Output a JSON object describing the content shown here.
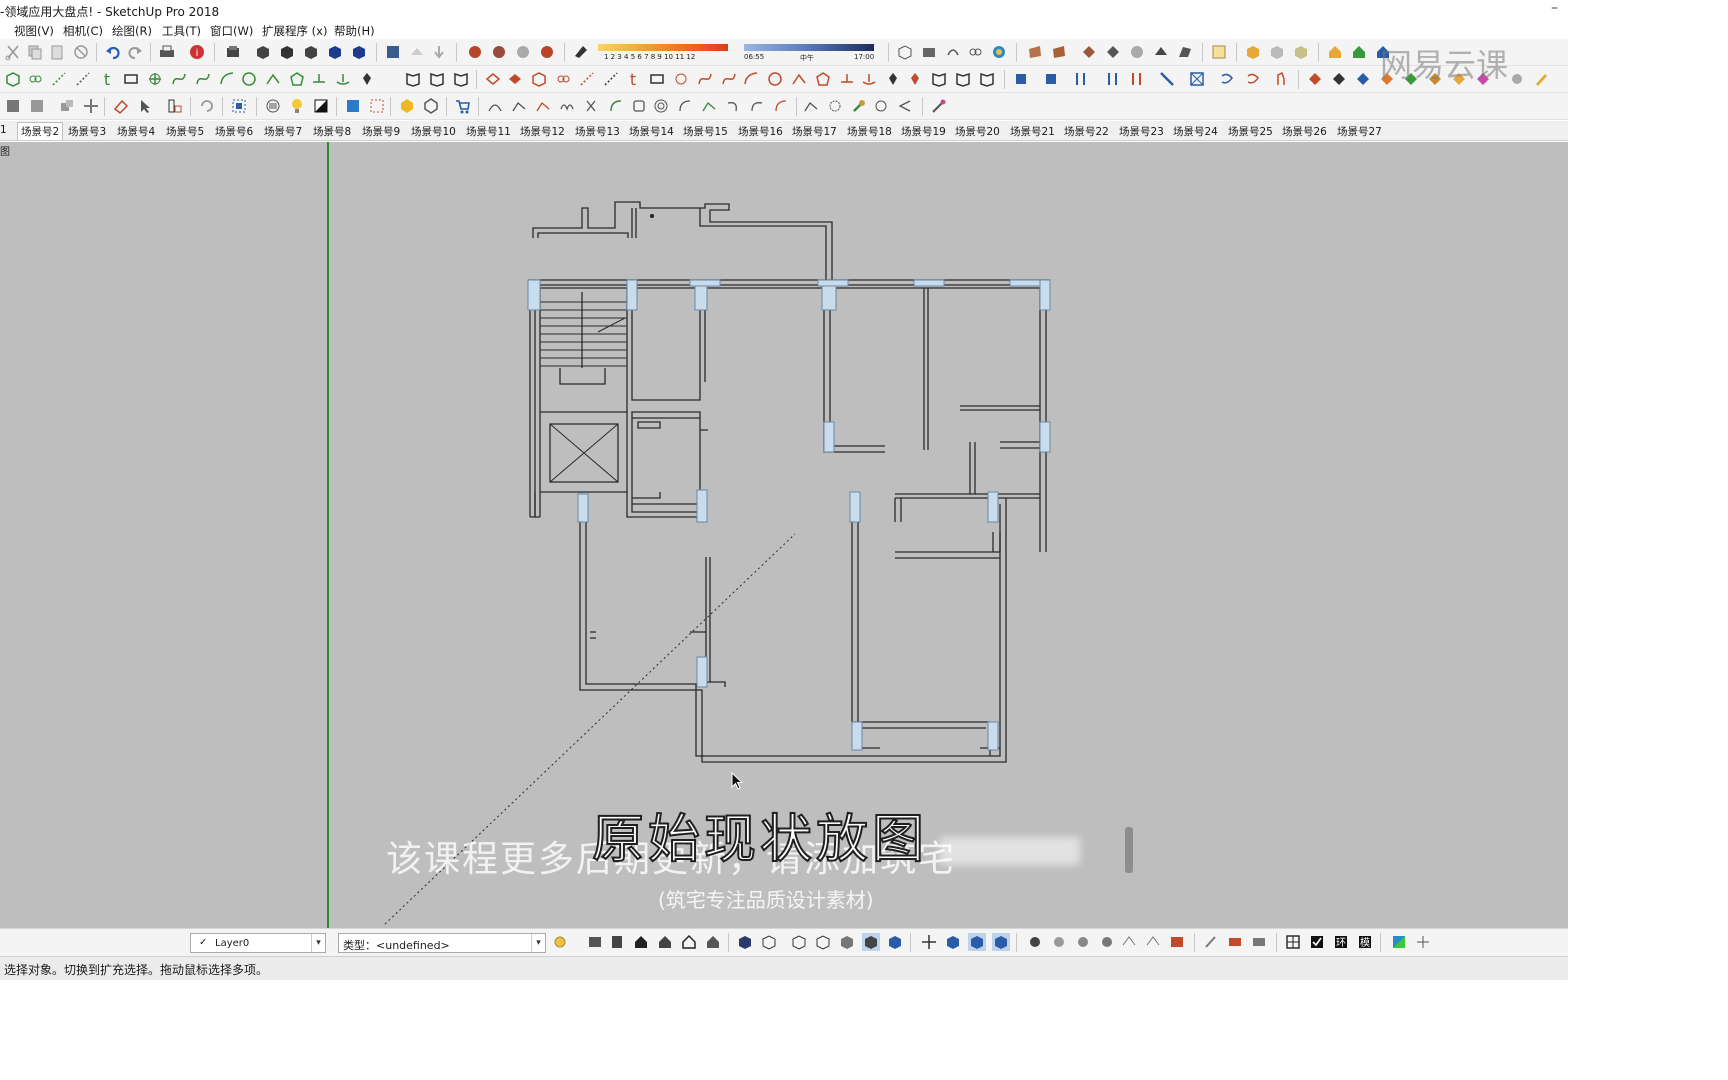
{
  "window": {
    "title": "-领域应用大盘点! - SketchUp Pro 2018",
    "minimize_glyph": "–"
  },
  "menu": {
    "items": [
      "视图(V)",
      "相机(C)",
      "绘图(R)",
      "工具(T)",
      "窗口(W)",
      "扩展程序 (x)",
      "帮助(H)"
    ]
  },
  "shadow_settings": {
    "months": "1 2 3 4 5 6 7 8 9 10 11 12",
    "time_start": "06:55",
    "noon": "中午",
    "time_end": "17:00"
  },
  "scene_tabs": {
    "items": [
      "1",
      "场景号2",
      "场景号3",
      "场景号4",
      "场景号5",
      "场景号6",
      "场景号7",
      "场景号8",
      "场景号9",
      "场景号10",
      "场景号11",
      "场景号12",
      "场景号13",
      "场景号14",
      "场景号15",
      "场景号16",
      "场景号17",
      "场景号18",
      "场景号19",
      "场景号20",
      "场景号21",
      "场景号22",
      "场景号23",
      "场景号24",
      "场景号25",
      "场景号26",
      "场景号27"
    ],
    "active_index": 1
  },
  "viewport": {
    "corner_label": "图",
    "background": "#bebebe",
    "green_axis_color": "#2f8a2f"
  },
  "subtitles": {
    "title": "原始现状放图",
    "promo": "该课程更多后期更新，请添加筑宅",
    "note": "(筑宅专注品质设计素材)"
  },
  "watermark": "网易云课",
  "bottom_toolbar": {
    "layer_check": "✓",
    "layer_name": "Layer0",
    "type_label": "类型：<undefined>",
    "dropdown_glyph": "▾"
  },
  "status": {
    "message": "选择对象。切换到扩充选择。拖动鼠标选择多项。"
  }
}
